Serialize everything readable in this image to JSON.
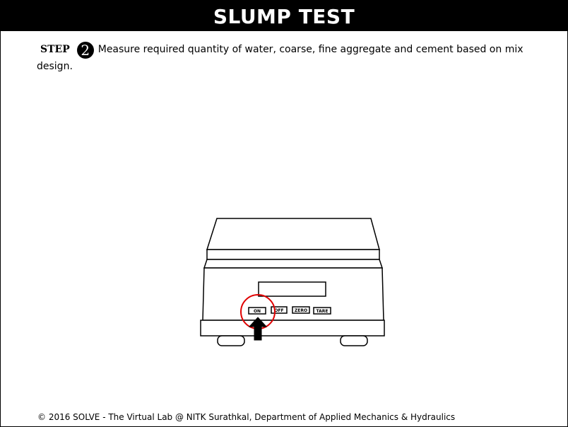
{
  "header": {
    "title": "SLUMP TEST"
  },
  "step": {
    "label": "STEP",
    "number": "2",
    "text": "Measure required quantity of water, coarse, fine aggregate and cement based on mix design."
  },
  "scale": {
    "buttons": {
      "on": "ON",
      "off": "OFF",
      "zero": "ZERO",
      "tare": "TARE"
    },
    "highlight_color": "#e00000"
  },
  "footer": {
    "text": "© 2016 SOLVE - The Virtual Lab @ NITK Surathkal, Department of Applied Mechanics & Hydraulics"
  }
}
